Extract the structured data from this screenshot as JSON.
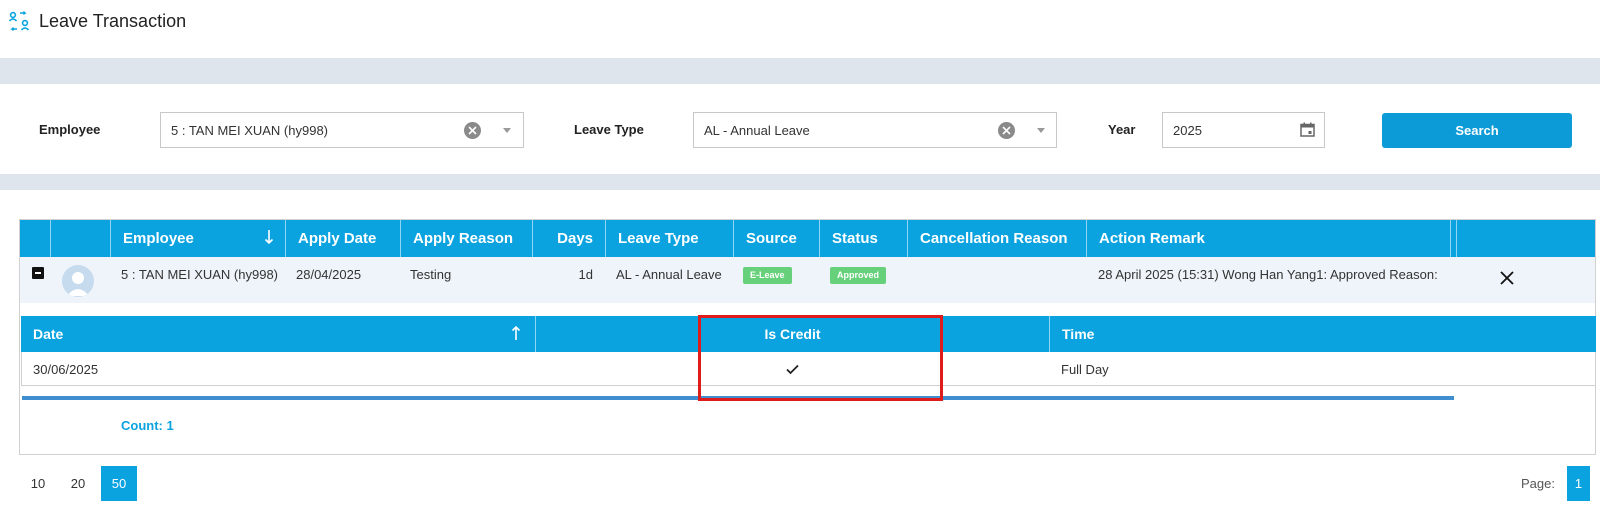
{
  "header": {
    "title": "Leave Transaction"
  },
  "filters": {
    "employee_label": "Employee",
    "employee_value": "5 : TAN MEI XUAN (hy998)",
    "leave_type_label": "Leave Type",
    "leave_type_value": "AL - Annual Leave",
    "year_label": "Year",
    "year_value": "2025",
    "search_label": "Search"
  },
  "grid": {
    "columns": [
      "Employee",
      "Apply Date",
      "Apply Reason",
      "Days",
      "Leave Type",
      "Source",
      "Status",
      "Cancellation Reason",
      "Action Remark"
    ],
    "row": {
      "employee": "5 : TAN MEI XUAN (hy998)",
      "apply_date": "28/04/2025",
      "apply_reason": "Testing",
      "days": "1d",
      "leave_type": "AL - Annual Leave",
      "source": "E-Leave",
      "status": "Approved",
      "cancellation_reason": "",
      "action_remark": "28 April 2025 (15:31) Wong Han Yang1: Approved Reason:"
    },
    "colors": {
      "header": "#0aa3e0",
      "source_badge": "#66d07a",
      "status_badge": "#66d07a",
      "highlight": "#e01b1b"
    }
  },
  "detail": {
    "columns": [
      "Date",
      "Is Credit",
      "Time"
    ],
    "row": {
      "date": "30/06/2025",
      "is_credit": true,
      "time": "Full Day"
    },
    "count": "Count: 1"
  },
  "pager": {
    "sizes": [
      "10",
      "20",
      "50"
    ],
    "selected_size": "50",
    "page_label": "Page:",
    "current_page": "1"
  }
}
